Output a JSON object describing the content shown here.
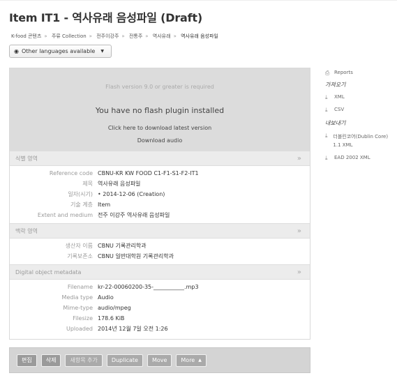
{
  "page": {
    "title": "Item IT1 - 역사유래 음성파일 (Draft)"
  },
  "breadcrumb": [
    "K-food 콘텐츠",
    "주류 Collection",
    "전주이강주",
    "전통주",
    "역사유래",
    "역사유래 음성파일"
  ],
  "languages_button": {
    "label": "Other languages available",
    "icon": "globe-icon"
  },
  "flash": {
    "required_text": "Flash version 9.0 or greater is required",
    "no_plugin_text": "You have no flash plugin installed",
    "download_plugin_text": "Click here to download latest version",
    "download_audio_text": "Download audio"
  },
  "sections": {
    "identity": {
      "title": "식별 영역",
      "rows": [
        {
          "label": "Reference code",
          "value": "CBNU-KR KW FOOD C1-F1-S1-F2-IT1"
        },
        {
          "label": "제목",
          "value": "역사유래 음성파일"
        },
        {
          "label": "일자(시기)",
          "value": "• 2014-12-06 (Creation)"
        },
        {
          "label": "기술 계층",
          "value": "Item"
        },
        {
          "label": "Extent and medium",
          "value": "전주 이강주 역사유래 음성파일"
        }
      ]
    },
    "context": {
      "title": "맥락 영역",
      "rows": [
        {
          "label": "생산자 이름",
          "value": "CBNU 기록관리학과"
        },
        {
          "label": "기록보존소",
          "value": "CBNU 일반대학원 기록관리학과"
        }
      ]
    },
    "digital": {
      "title": "Digital object metadata",
      "rows": [
        {
          "label": "Filename",
          "value": "kr-22-00060200-35-___________.mp3"
        },
        {
          "label": "Media type",
          "value": "Audio"
        },
        {
          "label": "Mime-type",
          "value": "audio/mpeg"
        },
        {
          "label": "Filesize",
          "value": "178.6 KiB"
        },
        {
          "label": "Uploaded",
          "value": "2014년 12월 7일 오전 1:26"
        }
      ]
    }
  },
  "actions": {
    "edit": "편집",
    "delete": "삭제",
    "add_new": "새항목 추가",
    "duplicate": "Duplicate",
    "move": "Move",
    "more": "More"
  },
  "sidebar": {
    "reports": "Reports",
    "import_header": "가져오기",
    "import_xml": "XML",
    "import_csv": "CSV",
    "export_header": "내보내기",
    "export_dc": "더블린코어(Dublin Core) 1.1 XML",
    "export_ead": "EAD 2002 XML"
  }
}
